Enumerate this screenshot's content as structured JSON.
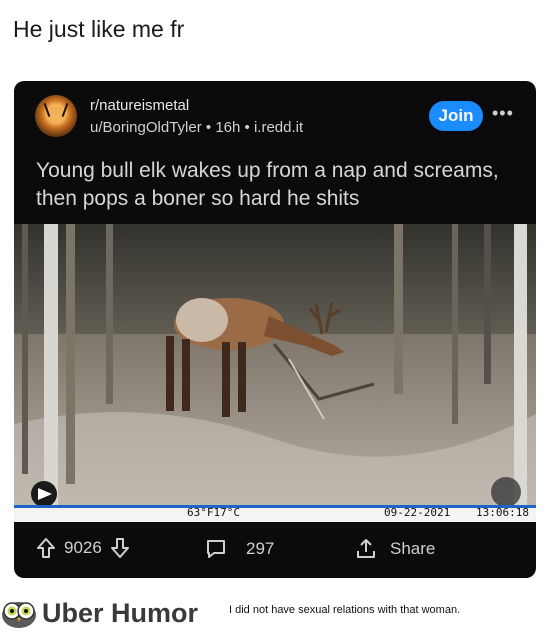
{
  "caption": "He just like me fr",
  "post": {
    "subreddit": "r/natureismetal",
    "user": "u/BoringOldTyler",
    "age": "16h",
    "domain": "i.redd.it",
    "separator": "•",
    "join_label": "Join",
    "more_label": "•••",
    "title": "Young bull elk wakes up from a nap and screams, then pops a boner so hard he shits",
    "camera": {
      "temperature": "63°F17°C",
      "date": "09-22-2021",
      "time": "13:06:18"
    },
    "upvotes": "9026",
    "comments": "297",
    "share_label": "Share"
  },
  "footer": {
    "brand": "Uber Humor",
    "quote": "I did not have sexual relations with that woman."
  },
  "colors": {
    "join": "#1a8cff",
    "card": "#0b0b0c",
    "stamp_line": "#1e63c8"
  }
}
